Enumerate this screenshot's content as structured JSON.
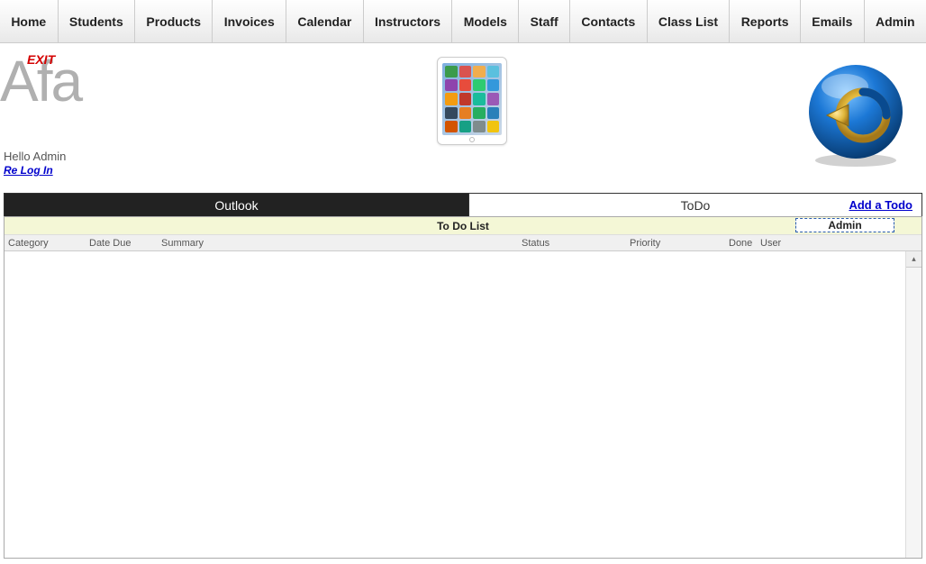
{
  "nav": {
    "items": [
      "Home",
      "Students",
      "Products",
      "Invoices",
      "Calendar",
      "Instructors",
      "Models",
      "Staff",
      "Contacts",
      "Class List",
      "Reports",
      "Emails",
      "Admin"
    ]
  },
  "header": {
    "exit": "EXIT",
    "brand": "Afa",
    "greeting": "Hello Admin",
    "relogin": "Re Log In"
  },
  "tabs": {
    "outlook": "Outlook",
    "todo": "ToDo",
    "add_todo": "Add a Todo"
  },
  "todo": {
    "title": "To Do List",
    "user_filter": "Admin",
    "columns": {
      "category": "Category",
      "date_due": "Date Due",
      "summary": "Summary",
      "status": "Status",
      "priority": "Priority",
      "done": "Done",
      "user": "User"
    },
    "rows": []
  },
  "ipad_icon_colors": [
    "#3b9b4c",
    "#d9534f",
    "#f0ad4e",
    "#5bc0de",
    "#8e44ad",
    "#e74c3c",
    "#2ecc71",
    "#3498db",
    "#f39c12",
    "#c0392b",
    "#1abc9c",
    "#9b59b6",
    "#34495e",
    "#e67e22",
    "#27ae60",
    "#2980b9",
    "#d35400",
    "#16a085",
    "#7f8c8d",
    "#f1c40f"
  ],
  "icons": {
    "scroll_up": "▴"
  }
}
